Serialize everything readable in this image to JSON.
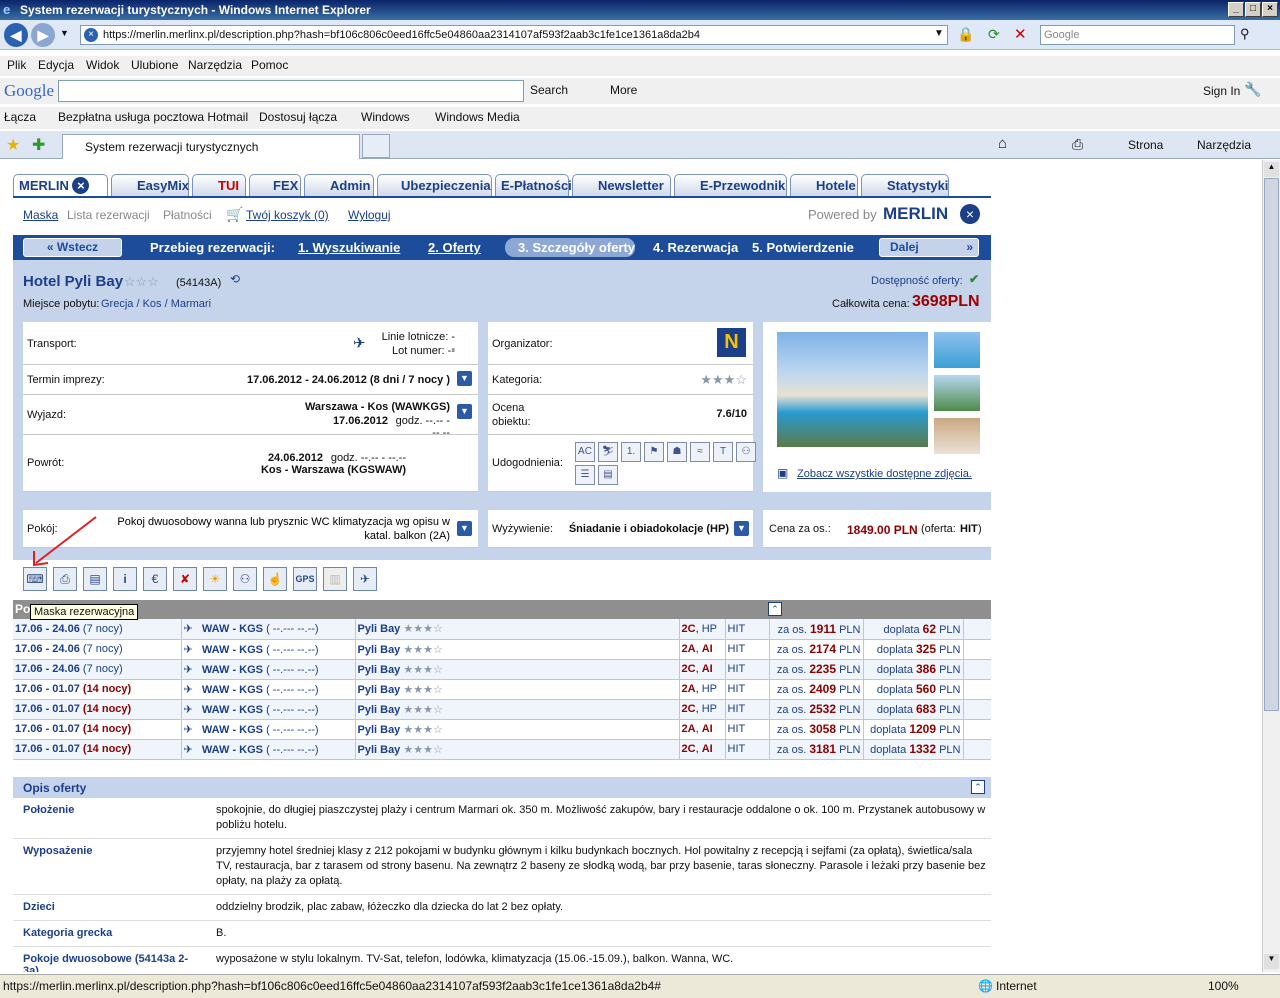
{
  "window": {
    "title": "System rezerwacji turystycznych - Windows Internet Explorer"
  },
  "address": {
    "url": "https://merlin.merlinx.pl/description.php?hash=bf106c806c0eed16ffc5e04860aa2314107af593f2aab3c1fe1ce1361a8da2b4",
    "search_placeholder": "Google"
  },
  "menu": [
    "Plik",
    "Edycja",
    "Widok",
    "Ulubione",
    "Narzędzia",
    "Pomoc"
  ],
  "gbar": {
    "logo": "Google",
    "search": "Search",
    "more": "More",
    "signin": "Sign In"
  },
  "links": {
    "label": "Łącza",
    "items": [
      "Bezpłatna usługa pocztowa Hotmail",
      "Dostosuj łącza",
      "Windows",
      "Windows Media"
    ]
  },
  "tab": {
    "title": "System rezerwacji turystycznych",
    "strona": "Strona",
    "narzedzia": "Narzędzia"
  },
  "mtabs": [
    "MERLIN",
    "EasyMix",
    "TUI",
    "FEX",
    "Admin",
    "Ubezpieczenia",
    "E-Płatności",
    "Newsletter",
    "E-Przewodnik",
    "Hotele",
    "Statystyki"
  ],
  "subnav": {
    "maska": "Maska",
    "lista": "Lista rezerwacji",
    "platnosci": "Płatności",
    "koszyk": "Twój koszyk (0)",
    "wyloguj": "Wyloguj",
    "powered": "Powered by",
    "brand": "MERLIN"
  },
  "steps": {
    "wstecz": "Wstecz",
    "label": "Przebieg rezerwacji:",
    "s1": "1. Wyszukiwanie",
    "s2": "2. Oferty",
    "s3": "3. Szczegóły oferty",
    "s4": "4. Rezerwacja",
    "s5": "5. Potwierdzenie",
    "dalej": "Dalej"
  },
  "hotel": {
    "name": "Hotel Pyli Bay",
    "code": "(54143A)",
    "place_label": "Miejsce pobytu:",
    "place": "Grecja / Kos / Marmari",
    "dostepnosc": "Dostępność oferty:",
    "cena_label": "Całkowita cena:",
    "cena": "3698PLN",
    "stars": "☆☆☆"
  },
  "details": {
    "transport_label": "Transport:",
    "linie": "Linie lotnicze: --",
    "lot": "Lot numer: --",
    "organizator_label": "Organizator:",
    "termin_label": "Termin imprezy:",
    "termin": "17.06.2012 - 24.06.2012 (8 dni / 7 nocy )",
    "kategoria_label": "Kategoria:",
    "kategoria_stars": "★★★☆",
    "wyjazd_label": "Wyjazd:",
    "wyjazd1": "Warszawa - Kos (WAWKGS)",
    "wyjazd2": "17.06.2012",
    "wyjazd3": "godz. --.-- - --.--",
    "ocena_label": "Ocena obiektu:",
    "ocena": "7.6/10",
    "powrot_label": "Powrót:",
    "powrot1": "24.06.2012",
    "powrot1b": "godz. --.-- - --.--",
    "powrot2": "Kos - Warszawa (KGSWAW)",
    "udogodnienia_label": "Udogodnienia:",
    "zdjecia": "Zobacz wszystkie dostępne zdjęcia.",
    "pokoj_label": "Pokój:",
    "pokoj": "Pokoj dwuosobowy wanna lub prysznic WC klimatyzacja wg opisu w katal. balkon (2A)",
    "wyzywienie_label": "Wyżywienie:",
    "wyzywienie": "Śniadanie i obiadokolacje (HP)",
    "cena_os_label": "Cena za os.:",
    "cena_os": "1849.00 PLN",
    "oferta_label": "(oferta:",
    "oferta": "HIT",
    ")": ")"
  },
  "tooltip": "Maska rezerwacyjna",
  "results_head": "Po",
  "results": [
    {
      "date": "17.06 - 24.06",
      "nights": "(7 nocy)",
      "route": "WAW - KGS",
      "time": "( --.--- --.--)",
      "hotel": "Pyli Bay",
      "room": "2C",
      "board": "HP",
      "type": "HIT",
      "price": "1911",
      "doplata": "62"
    },
    {
      "date": "17.06 - 24.06",
      "nights": "(7 nocy)",
      "route": "WAW - KGS",
      "time": "( --.--- --.--)",
      "hotel": "Pyli Bay",
      "room": "2A",
      "board": "AI",
      "type": "HIT",
      "price": "2174",
      "doplata": "325"
    },
    {
      "date": "17.06 - 24.06",
      "nights": "(7 nocy)",
      "route": "WAW - KGS",
      "time": "( --.--- --.--)",
      "hotel": "Pyli Bay",
      "room": "2C",
      "board": "AI",
      "type": "HIT",
      "price": "2235",
      "doplata": "386"
    },
    {
      "date": "17.06 - 01.07",
      "nights": "(14 nocy)",
      "route": "WAW - KGS",
      "time": "( --.--- --.--)",
      "hotel": "Pyli Bay",
      "room": "2A",
      "board": "HP",
      "type": "HIT",
      "price": "2409",
      "doplata": "560"
    },
    {
      "date": "17.06 - 01.07",
      "nights": "(14 nocy)",
      "route": "WAW - KGS",
      "time": "( --.--- --.--)",
      "hotel": "Pyli Bay",
      "room": "2C",
      "board": "HP",
      "type": "HIT",
      "price": "2532",
      "doplata": "683"
    },
    {
      "date": "17.06 - 01.07",
      "nights": "(14 nocy)",
      "route": "WAW - KGS",
      "time": "( --.--- --.--)",
      "hotel": "Pyli Bay",
      "room": "2A",
      "board": "AI",
      "type": "HIT",
      "price": "3058",
      "doplata": "1209"
    },
    {
      "date": "17.06 - 01.07",
      "nights": "(14 nocy)",
      "route": "WAW - KGS",
      "time": "( --.--- --.--)",
      "hotel": "Pyli Bay",
      "room": "2C",
      "board": "AI",
      "type": "HIT",
      "price": "3181",
      "doplata": "1332"
    }
  ],
  "results_labels": {
    "za_os": "za os.",
    "pln": "PLN",
    "doplata": "doplata",
    "stars": "★★★☆"
  },
  "opis": {
    "title": "Opis oferty",
    "rows": [
      {
        "k": "Położenie",
        "v": "spokojnie, do długiej piaszczystej plaży i centrum Marmari ok. 350 m. Możliwość zakupów, bary i restauracje oddalone o ok. 100 m. Przystanek autobusowy w pobliżu hotelu."
      },
      {
        "k": "Wyposażenie",
        "v": "przyjemny hotel średniej klasy z 212 pokojami w budynku głównym i kilku budynkach bocznych. Hol powitalny z recepcją i sejfami (za opłatą), świetlica/sala TV, restauracja, bar z tarasem od strony basenu. Na zewnątrz 2 baseny ze słodką wodą, bar przy basenie, taras słoneczny. Parasole i leżaki przy basenie bez opłaty, na plaży za opłatą."
      },
      {
        "k": "Dzieci",
        "v": "oddzielny brodzik, plac zabaw, łóżeczko dla dziecka do lat 2 bez opłaty."
      },
      {
        "k": "Kategoria grecka",
        "v": "B."
      },
      {
        "k": "Pokoje dwuosobowe (54143a 2-3a)",
        "v": "wyposażone w stylu lokalnym. TV-Sat, telefon, lodówka, klimatyzacja (15.06.-15.09.), balkon. Wanna, WC."
      }
    ]
  },
  "status": {
    "url": "https://merlin.merlinx.pl/description.php?hash=bf106c806c0eed16ffc5e04860aa2314107af593f2aab3c1fe1ce1361a8da2b4#",
    "zone": "Internet",
    "zoom": "100%"
  }
}
